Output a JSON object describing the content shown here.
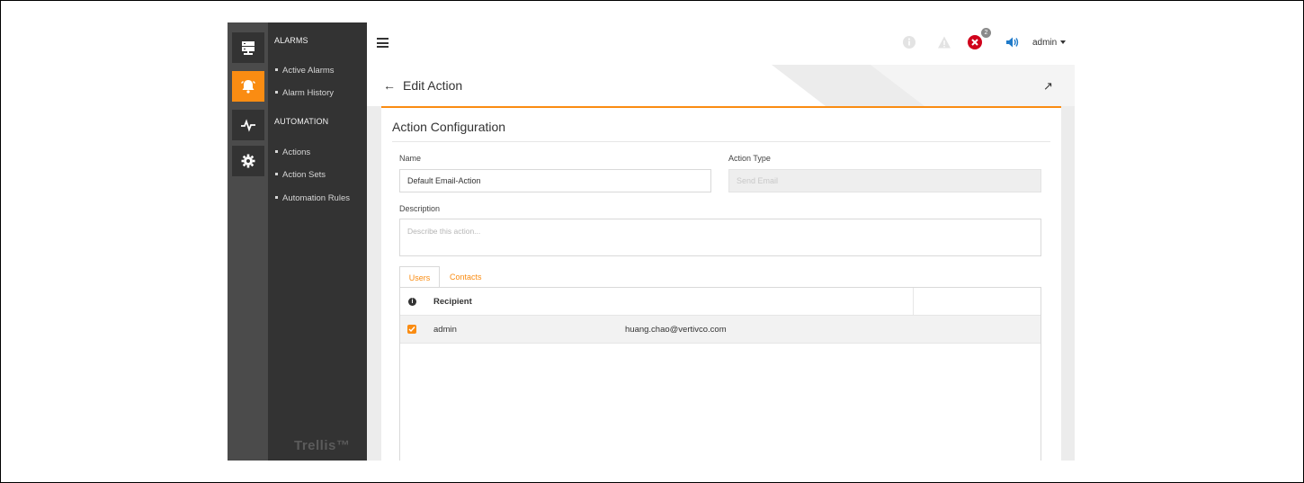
{
  "sidebar": {
    "sections": [
      {
        "heading": "ALARMS",
        "items": [
          "Active Alarms",
          "Alarm History"
        ]
      },
      {
        "heading": "AUTOMATION",
        "items": [
          "Actions",
          "Action Sets",
          "Automation Rules"
        ]
      }
    ],
    "brand": "Trellis™",
    "rail_icons": [
      "server-icon",
      "alarm-bell-icon",
      "pulse-icon",
      "settings-gear-icon"
    ]
  },
  "topbar": {
    "notification_count": "2",
    "user": "admin",
    "icons": [
      "info-icon",
      "warning-icon",
      "critical-alarm-icon",
      "speaker-icon"
    ]
  },
  "page": {
    "title": "Edit Action",
    "back_glyph": "←",
    "expand_glyph": "↗"
  },
  "card": {
    "title": "Action Configuration",
    "name_label": "Name",
    "name_value": "Default Email-Action",
    "type_label": "Action Type",
    "type_value": "Send Email",
    "description_label": "Description",
    "description_placeholder": "Describe this action...",
    "tabs": [
      "Users",
      "Contacts"
    ],
    "table": {
      "header": "Recipient",
      "rows": [
        {
          "checked": true,
          "user": "admin",
          "email": "huang.chao@vertivco.com"
        }
      ]
    }
  },
  "colors": {
    "accent": "#fa8c12",
    "sidebar_dark": "#333333",
    "rail": "#4b4b4b",
    "critical": "#d0021b",
    "speaker": "#1f7ac9"
  }
}
